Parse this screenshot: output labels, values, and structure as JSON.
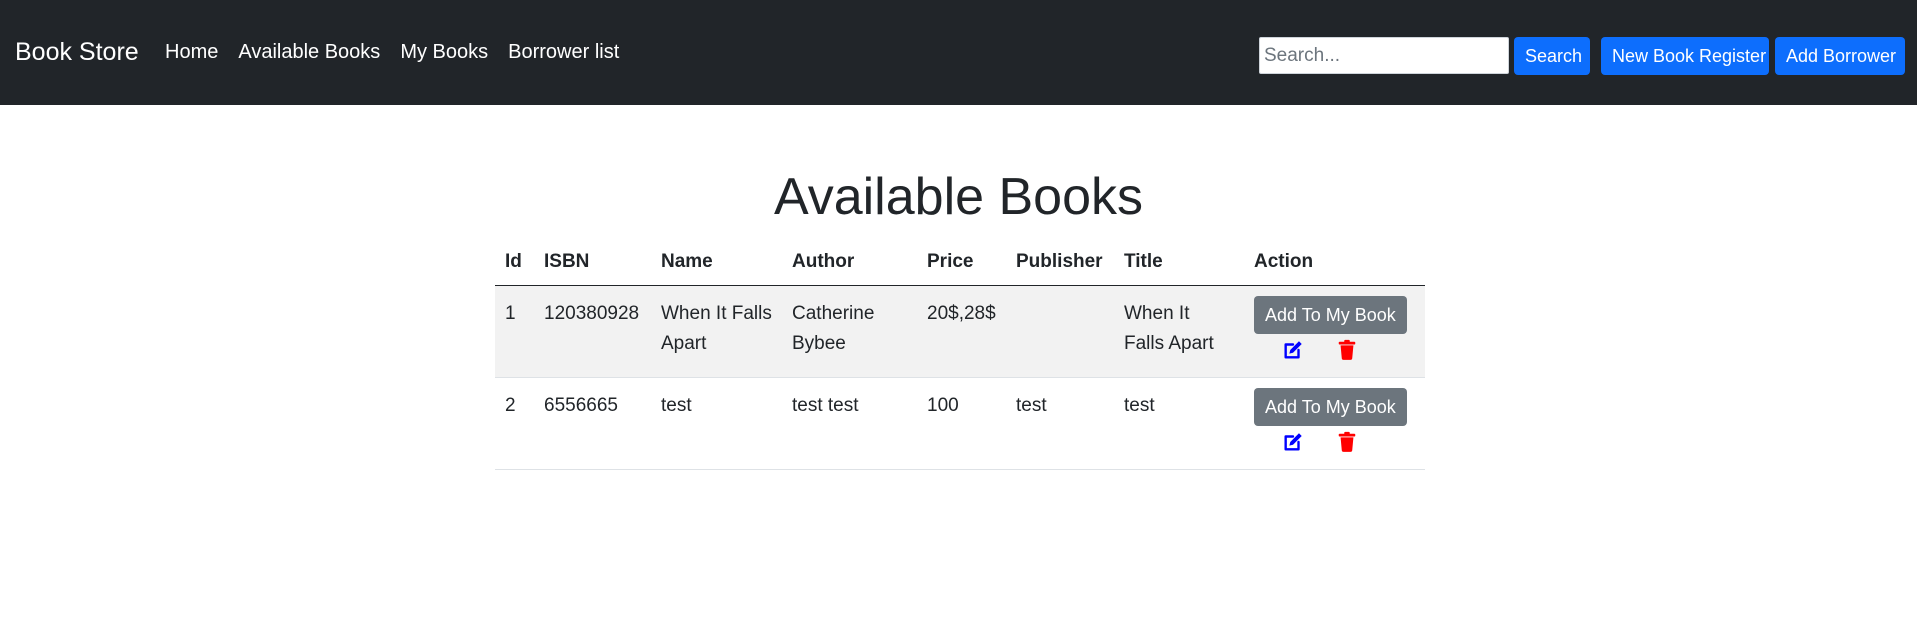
{
  "navbar": {
    "brand": "Book Store",
    "links": [
      "Home",
      "Available Books",
      "My Books",
      "Borrower list"
    ],
    "search_placeholder": "Search...",
    "search_value": "",
    "search_button": "Search",
    "new_book_button": "New Book Register",
    "add_borrower_button": "Add Borrower"
  },
  "page": {
    "title": "Available Books"
  },
  "table": {
    "headers": [
      "Id",
      "ISBN",
      "Name",
      "Author",
      "Price",
      "Publisher",
      "Title",
      "Action"
    ],
    "rows": [
      {
        "id": "1",
        "isbn": "120380928",
        "name": "When It Falls Apart",
        "author": "Catherine Bybee",
        "price": "20$,28$",
        "publisher": "",
        "title": "When It Falls Apart",
        "action_label": "Add To My Book"
      },
      {
        "id": "2",
        "isbn": "6556665",
        "name": "test",
        "author": "test test",
        "price": "100",
        "publisher": "test",
        "title": "test",
        "action_label": "Add To My Book"
      }
    ]
  },
  "colors": {
    "navbar_bg": "#212529",
    "primary": "#0d6efd",
    "secondary": "#6c757d",
    "edit_icon": "#0000ff",
    "delete_icon": "#ff0000"
  },
  "icons": {
    "edit": "edit-icon",
    "delete": "trash-icon"
  }
}
